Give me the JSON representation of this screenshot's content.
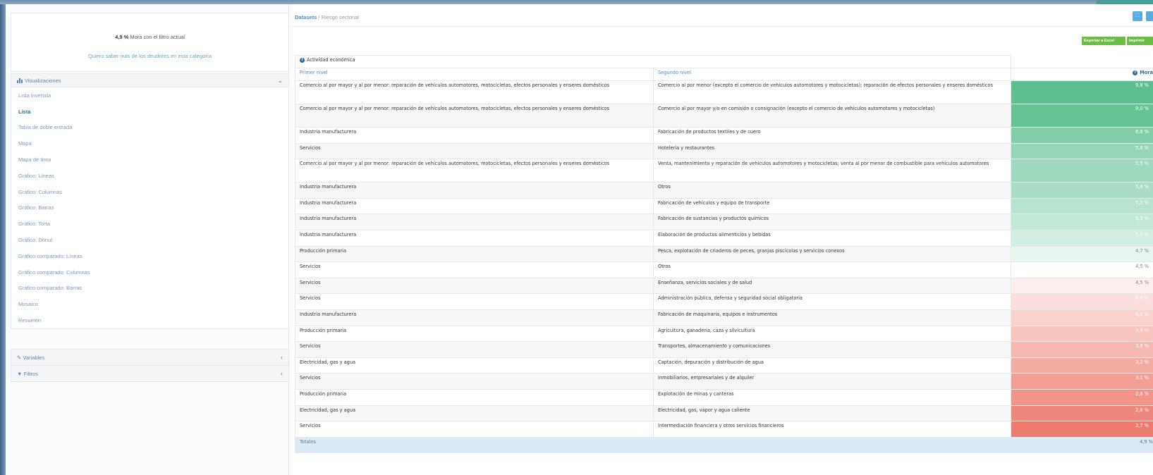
{
  "sidebar": {
    "info": {
      "value": "4,9 %",
      "text": "Mora con el filtro actual",
      "link": "Quiero saber más de los deudores en esta categoría"
    },
    "visualizations": {
      "title": "Visualizaciones",
      "items": [
        "Lista invertida",
        "Lista",
        "Tabla de doble entrada",
        "Mapa",
        "Mapa de área",
        "Gráfico: Líneas",
        "Gráfico: Columnas",
        "Gráfico: Barras",
        "Gráfico: Torta",
        "Gráfico: Donut",
        "Gráfico comparado: Líneas",
        "Gráfico comparado: Columnas",
        "Gráfico comparado: Barras",
        "Mosaico",
        "Resumen"
      ],
      "active_index": 1
    },
    "variables_label": "Variables",
    "filtros_label": "Filtros"
  },
  "breadcrumb": {
    "link": "Datasets",
    "separator": "/",
    "current": "Riesgo sectorial"
  },
  "buttons": {
    "export_excel": "Exportar a Excel",
    "print": "Imprimir"
  },
  "table": {
    "group_header": "Actividad económica",
    "col_primer": "Primer nivel",
    "col_segundo": "Segundo nivel",
    "col_mora": "Mora",
    "rows": [
      {
        "primer": "Comercio al por mayor y al por menor: reparación de vehículos automotores, motocicletas, efectos personales y enseres domésticos",
        "segundo": "Comercio al por menor (excepto el comercio de vehículos automotores y motocicletas); reparación de efectos personales y enseres domésticos",
        "mora": "9,8 %",
        "tall": true,
        "color": "#5cbf8f"
      },
      {
        "primer": "Comercio al por mayor y al por menor: reparación de vehículos automotores, motocicletas, efectos personales y enseres domésticos",
        "segundo": "Comercio al por mayor y/o en comisión o consignación (excepto el comercio de vehículos automotores y motocicletas)",
        "mora": "9,0 %",
        "tall": true,
        "color": "#66c395"
      },
      {
        "primer": "Industria manufacturera",
        "segundo": "Fabricación de productos textiles y de cuero",
        "mora": "6,6 %",
        "tall": false,
        "color": "#82cea8"
      },
      {
        "primer": "Servicios",
        "segundo": "Hotelería y restaurantes",
        "mora": "5,8 %",
        "tall": false,
        "color": "#96d6b6"
      },
      {
        "primer": "Comercio al por mayor y al por menor: reparación de vehículos automotores, motocicletas, efectos personales y enseres domésticos",
        "segundo": "Venta, mantenimiento y reparación de vehículos automotores y motocicletas; venta al por menor de combustible para vehículos automotores",
        "mora": "5,5 %",
        "tall": true,
        "color": "#a0dabe"
      },
      {
        "primer": "Industria manufacturera",
        "segundo": "Otros",
        "mora": "5,4 %",
        "tall": false,
        "color": "#aadec4"
      },
      {
        "primer": "Industria manufacturera",
        "segundo": "Fabricación de vehículos y equipo de transporte",
        "mora": "5,3 %",
        "tall": false,
        "color": "#b8e4ce"
      },
      {
        "primer": "Industria manufacturera",
        "segundo": "Fabricación de sustancias y productos químicos",
        "mora": "5,3 %",
        "tall": false,
        "color": "#c3e8d6"
      },
      {
        "primer": "Industria manufacturera",
        "segundo": "Elaboración de productos alimenticios y bebidas",
        "mora": "5,2 %",
        "tall": false,
        "color": "#d2eee0"
      },
      {
        "primer": "Producción primaria",
        "segundo": "Pesca, explotación de criaderos de peces, granjas piscícolas y servicios conexos",
        "mora": "4,7 %",
        "tall": false,
        "color": "#e6f5ed"
      },
      {
        "primer": "Servicios",
        "segundo": "Otros",
        "mora": "4,5 %",
        "tall": false,
        "color": "#ffffff"
      },
      {
        "primer": "Servicios",
        "segundo": "Enseñanza, servicios sociales y de salud",
        "mora": "4,5 %",
        "tall": false,
        "color": "#fdeeee"
      },
      {
        "primer": "Servicios",
        "segundo": "Administración pública, defensa y seguridad social obligatoria",
        "mora": "4,4 %",
        "tall": false,
        "color": "#fbdfdd"
      },
      {
        "primer": "Industria manufacturera",
        "segundo": "Fabricación de maquinaria, equipos e instrumentos",
        "mora": "4,2 %",
        "tall": false,
        "color": "#f9d1cd"
      },
      {
        "primer": "Producción primaria",
        "segundo": "Agricultura, ganadería, caza y silvicultura",
        "mora": "3,9 %",
        "tall": false,
        "color": "#f8c4be"
      },
      {
        "primer": "Servicios",
        "segundo": "Transportes, almacenamiento y comunicaciones",
        "mora": "3,8 %",
        "tall": false,
        "color": "#f6b8b1"
      },
      {
        "primer": "Electricidad, gas y agua",
        "segundo": "Captación, depuración y distribución de agua",
        "mora": "3,2 %",
        "tall": false,
        "color": "#f4aba2"
      },
      {
        "primer": "Servicios",
        "segundo": "Inmobiliarios, empresariales y de alquiler",
        "mora": "3,1 %",
        "tall": false,
        "color": "#f39f95"
      },
      {
        "primer": "Producción primaria",
        "segundo": "Explotación de minas y canteras",
        "mora": "2,8 %",
        "tall": false,
        "color": "#f19388"
      },
      {
        "primer": "Electricidad, gas y agua",
        "segundo": "Electricidad, gas, vapor y agua caliente",
        "mora": "2,8 %",
        "tall": false,
        "color": "#ef887c"
      },
      {
        "primer": "Servicios",
        "segundo": "Intermediación financiera y otros servicios financieros",
        "mora": "2,7 %",
        "tall": false,
        "color": "#ec7b6d"
      }
    ],
    "totals_label": "Totales",
    "totals_mora": "4,9 %"
  },
  "icons": {
    "bar_chart": "bar-chart-icon",
    "variables": "edit-icon",
    "filter": "filter-icon",
    "info": "info-icon",
    "expand": "expand-icon"
  }
}
